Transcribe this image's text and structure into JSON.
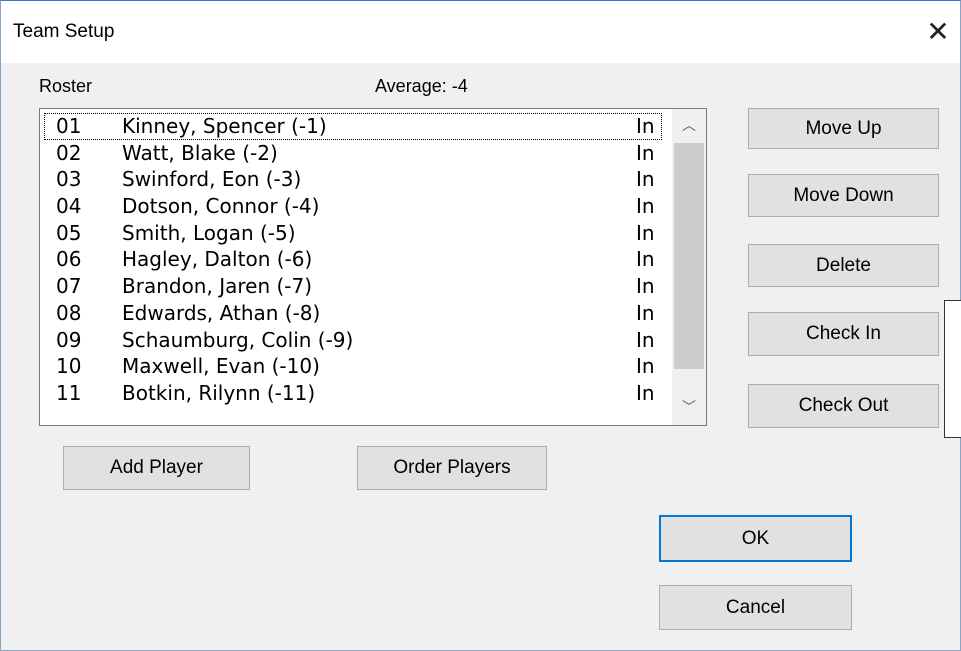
{
  "window": {
    "title": "Team Setup"
  },
  "roster": {
    "label": "Roster",
    "average": "Average: -4",
    "players": [
      {
        "num": "01",
        "name": "Kinney, Spencer (-1)",
        "status": "In"
      },
      {
        "num": "02",
        "name": "Watt, Blake (-2)",
        "status": "In"
      },
      {
        "num": "03",
        "name": "Swinford, Eon (-3)",
        "status": "In"
      },
      {
        "num": "04",
        "name": "Dotson, Connor (-4)",
        "status": "In"
      },
      {
        "num": "05",
        "name": "Smith, Logan (-5)",
        "status": "In"
      },
      {
        "num": "06",
        "name": "Hagley, Dalton (-6)",
        "status": "In"
      },
      {
        "num": "07",
        "name": "Brandon, Jaren (-7)",
        "status": "In"
      },
      {
        "num": "08",
        "name": "Edwards, Athan (-8)",
        "status": "In"
      },
      {
        "num": "09",
        "name": "Schaumburg, Colin (-9)",
        "status": "In"
      },
      {
        "num": "10",
        "name": "Maxwell, Evan (-10)",
        "status": "In"
      },
      {
        "num": "11",
        "name": "Botkin, Rilynn (-11)",
        "status": "In"
      }
    ]
  },
  "buttons": {
    "move_up": "Move Up",
    "move_down": "Move Down",
    "delete": "Delete",
    "check_in": "Check In",
    "check_out": "Check Out",
    "add_player": "Add Player",
    "order_players": "Order Players",
    "ok": "OK",
    "cancel": "Cancel"
  },
  "icons": {
    "close": "close-icon",
    "scroll_up": "chevron-up-icon",
    "scroll_down": "chevron-down-icon"
  },
  "colors": {
    "default_button_border": "#0078d7",
    "dialog_background": "#f0f0f0"
  }
}
